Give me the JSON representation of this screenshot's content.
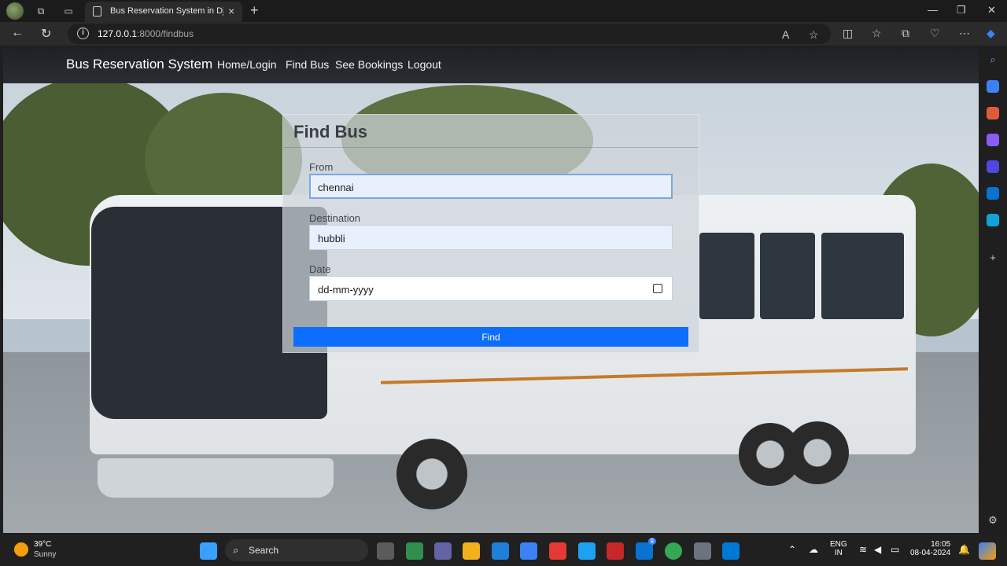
{
  "browser": {
    "tab_title": "Bus Reservation System in Django",
    "url_host": "127.0.0.1",
    "url_path": ":8000/findbus",
    "new_tab_symbol": "+",
    "close_symbol": "×"
  },
  "site": {
    "brand": "Bus Reservation System",
    "nav": [
      "Home/Login",
      "Find Bus",
      "See Bookings",
      "Logout"
    ]
  },
  "form": {
    "title": "Find Bus",
    "from_label": "From",
    "from_value": "chennai",
    "destination_label": "Destination",
    "destination_value": "hubbli",
    "date_label": "Date",
    "date_placeholder": "dd-mm-yyyy",
    "submit_label": "Find"
  },
  "taskbar": {
    "weather_temp": "39°C",
    "weather_desc": "Sunny",
    "search_label": "Search",
    "lang_1": "ENG",
    "lang_2": "IN",
    "time": "16:05",
    "date": "08-04-2024",
    "badge_count": "9"
  },
  "colors": {
    "primary_button": "#0d6efd",
    "navbar": "#22262b",
    "input_autofill": "#e8f0fe"
  }
}
